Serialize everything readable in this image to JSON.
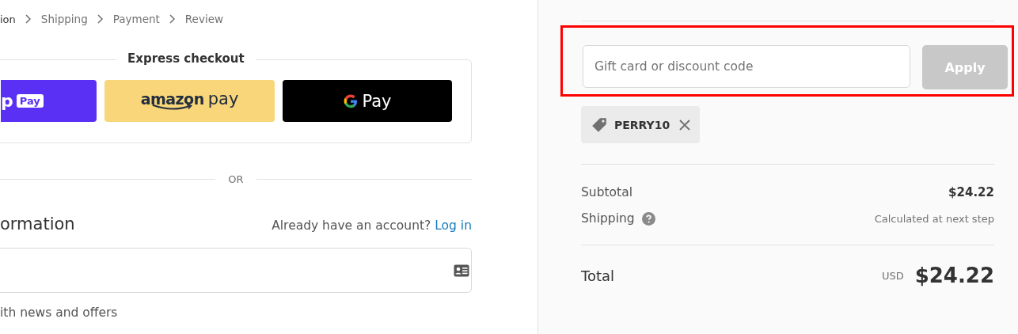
{
  "breadcrumbs": [
    {
      "label": "ion",
      "selected": true
    },
    {
      "label": "Shipping",
      "selected": false
    },
    {
      "label": "Payment",
      "selected": false
    },
    {
      "label": "Review",
      "selected": false
    }
  ],
  "express_checkout": {
    "title": "Express checkout",
    "buttons": [
      {
        "kind": "shop_pay",
        "label": "p",
        "badge": "Pay"
      },
      {
        "kind": "amazon_pay",
        "label": "amazon",
        "suffix": "pay"
      },
      {
        "kind": "google_pay",
        "label": "Pay"
      }
    ]
  },
  "divider": "OR",
  "contact": {
    "heading": "ormation",
    "login_prompt": "Already have an account?",
    "login_link": "Log in",
    "newsletter": "ith news and offers"
  },
  "summary": {
    "discount": {
      "placeholder": "Gift card or discount code",
      "button": "Apply",
      "disabled": true,
      "highlighted": true
    },
    "applied_codes": [
      {
        "code": "PERRY10"
      }
    ],
    "lines": [
      {
        "kind": "amount",
        "label": "Subtotal",
        "value": "$24.22",
        "help": false
      },
      {
        "kind": "note",
        "label": "Shipping",
        "value": "Calculated at next step",
        "help": true
      }
    ],
    "total": {
      "label": "Total",
      "currency": "USD",
      "amount": "$24.22"
    }
  }
}
